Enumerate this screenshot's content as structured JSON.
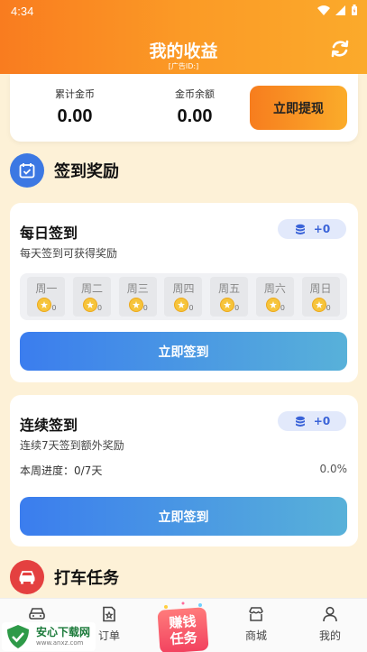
{
  "status": {
    "time": "4:34"
  },
  "header": {
    "title": "我的收益",
    "ad_id": "[广告ID:]"
  },
  "balance": {
    "total_label": "累计金币",
    "total_value": "0.00",
    "remain_label": "金币余额",
    "remain_value": "0.00",
    "withdraw_label": "立即提现"
  },
  "checkin_section": {
    "title": "签到奖励"
  },
  "daily": {
    "title": "每日签到",
    "subtitle": "每天签到可获得奖励",
    "badge": "+0",
    "days": [
      {
        "name": "周一",
        "coins": "0"
      },
      {
        "name": "周二",
        "coins": "0"
      },
      {
        "name": "周三",
        "coins": "0"
      },
      {
        "name": "周四",
        "coins": "0"
      },
      {
        "name": "周五",
        "coins": "0"
      },
      {
        "name": "周六",
        "coins": "0"
      },
      {
        "name": "周日",
        "coins": "0"
      }
    ],
    "button": "立即签到"
  },
  "streak": {
    "title": "连续签到",
    "subtitle": "连续7天签到额外奖励",
    "badge": "+0",
    "progress_label": "本周进度：0/7天",
    "progress_pct": "0.0%",
    "button": "立即签到"
  },
  "taxi_section": {
    "title": "打车任务"
  },
  "nav": {
    "item1": "",
    "orders": "订单",
    "center_line1": "赚钱",
    "center_line2": "任务",
    "mall": "商城",
    "mine": "我的"
  },
  "watermark": {
    "text": "安心下载网",
    "url": "www.anxz.com"
  },
  "colors": {
    "header_from": "#f97c1f",
    "header_to": "#fbaa2b",
    "primary_btn": "#3b7dee",
    "background": "#fdf1d7"
  }
}
